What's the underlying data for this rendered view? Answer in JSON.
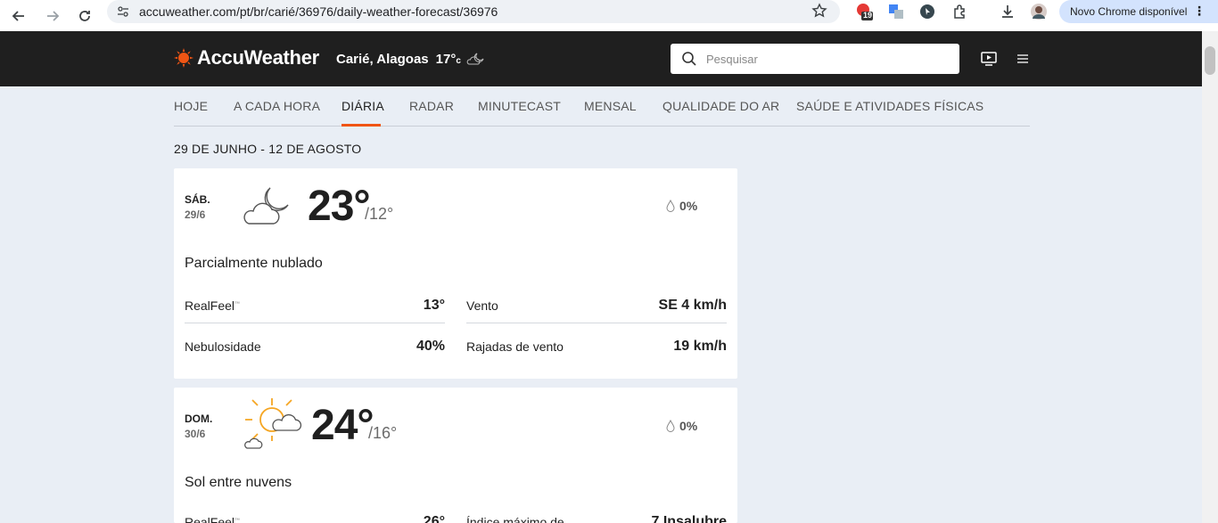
{
  "browser": {
    "url": "accuweather.com/pt/br/carié/36976/daily-weather-forecast/36976",
    "ext_badge": "19",
    "update_label": "Novo Chrome disponível"
  },
  "header": {
    "logo_text": "AccuWeather",
    "location": "Carié, Alagoas",
    "temp": "17°",
    "temp_unit": "c",
    "search_placeholder": "Pesquisar"
  },
  "tabs": [
    {
      "label": "HOJE"
    },
    {
      "label": "A CADA HORA"
    },
    {
      "label": "DIÁRIA"
    },
    {
      "label": "RADAR"
    },
    {
      "label": "MINUTECAST"
    },
    {
      "label": "MENSAL"
    },
    {
      "label": "QUALIDADE DO AR"
    },
    {
      "label": "SAÚDE E ATIVIDADES FÍSICAS"
    }
  ],
  "date_range": "29 DE JUNHO - 12 DE AGOSTO",
  "days": [
    {
      "dow": "SÁB.",
      "date": "29/6",
      "hi": "23°",
      "lo": "/12°",
      "precip": "0%",
      "phrase": "Parcialmente nublado",
      "left": [
        {
          "label": "RealFeel",
          "tm": "™",
          "value": "13°"
        },
        {
          "label": "Nebulosidade",
          "value": "40%"
        }
      ],
      "right": [
        {
          "label": "Vento",
          "value": "SE 4 km/h"
        },
        {
          "label": "Rajadas de vento",
          "value": "19 km/h"
        }
      ]
    },
    {
      "dow": "DOM.",
      "date": "30/6",
      "hi": "24°",
      "lo": "/16°",
      "precip": "0%",
      "phrase": "Sol entre nuvens",
      "left": [
        {
          "label": "RealFeel",
          "tm": "™",
          "value": "26°"
        }
      ],
      "right": [
        {
          "label": "Índice máximo de",
          "value": "7 Insalubre"
        }
      ]
    }
  ],
  "colors": {
    "accent": "#f05514",
    "header_bg": "#1f1f1f",
    "page_bg": "#e9eef5"
  }
}
